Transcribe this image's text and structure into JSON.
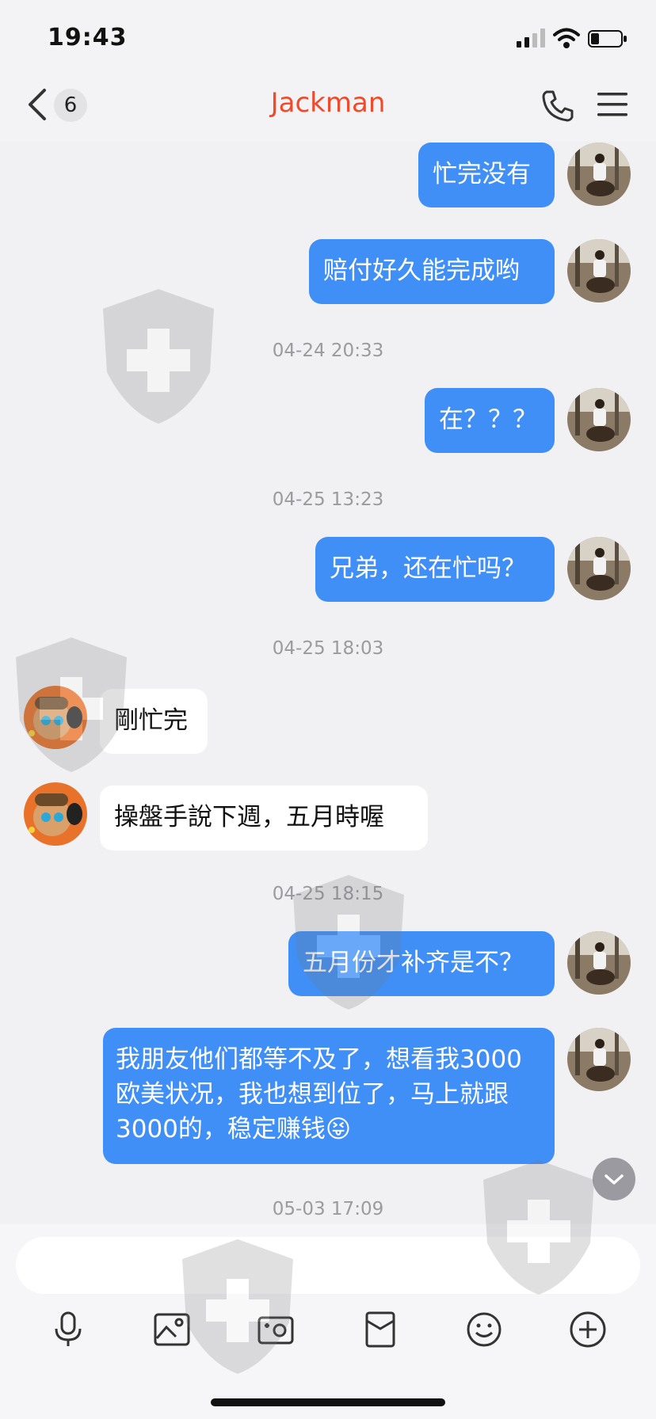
{
  "status_bar": {
    "time": "19:43"
  },
  "header": {
    "unread_count": "6",
    "title": "Jackman"
  },
  "messages": [
    {
      "text": "忙完没有"
    },
    {
      "text": "赔付好久能完成哟"
    },
    {
      "timestamp": "04-24 20:33"
    },
    {
      "text": "在？？？"
    },
    {
      "timestamp": "04-25 13:23"
    },
    {
      "text": "兄弟，还在忙吗？"
    },
    {
      "timestamp": "04-25 18:03"
    },
    {
      "text": "剛忙完"
    },
    {
      "text": "操盤手說下週，五月時喔"
    },
    {
      "timestamp": "04-25 18:15"
    },
    {
      "text": "五月份才补齐是不？"
    },
    {
      "text": "我朋友他们都等不及了，想看我3000欧美状况，我也想到位了，马上就跟3000的，稳定赚钱",
      "emoji": "😝"
    },
    {
      "timestamp": "05-03 17:09"
    }
  ],
  "composer": {
    "placeholder": ""
  },
  "toolbar": {
    "icons": [
      "microphone-icon",
      "photo-icon",
      "camera-icon",
      "red-packet-icon",
      "emoji-icon",
      "plus-icon"
    ]
  },
  "colors": {
    "outgoing_bubble": "#3f8ff7",
    "incoming_bubble": "#ffffff",
    "title": "#f04a2a"
  }
}
